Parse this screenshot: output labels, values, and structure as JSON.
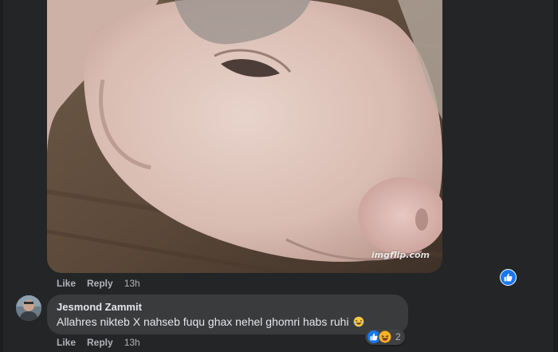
{
  "post_gif": {
    "watermark": "imgflip.com"
  },
  "gif_actions": {
    "like": "Like",
    "reply": "Reply",
    "time": "13h"
  },
  "comment": {
    "author": "Jesmond Zammit",
    "text": "Allahres nikteb X nahseb fuqu ghax nehel ghomri habs ruhi",
    "emoji": "rofl-emoji",
    "reactions": {
      "icons": [
        "like-icon",
        "haha-icon"
      ],
      "count": "2"
    },
    "actions": {
      "like": "Like",
      "reply": "Reply",
      "time": "13h"
    }
  },
  "colors": {
    "background": "#242526",
    "bubble": "#3a3b3c",
    "secondary_text": "#b0b3b8",
    "like_blue": "#1877f2"
  }
}
